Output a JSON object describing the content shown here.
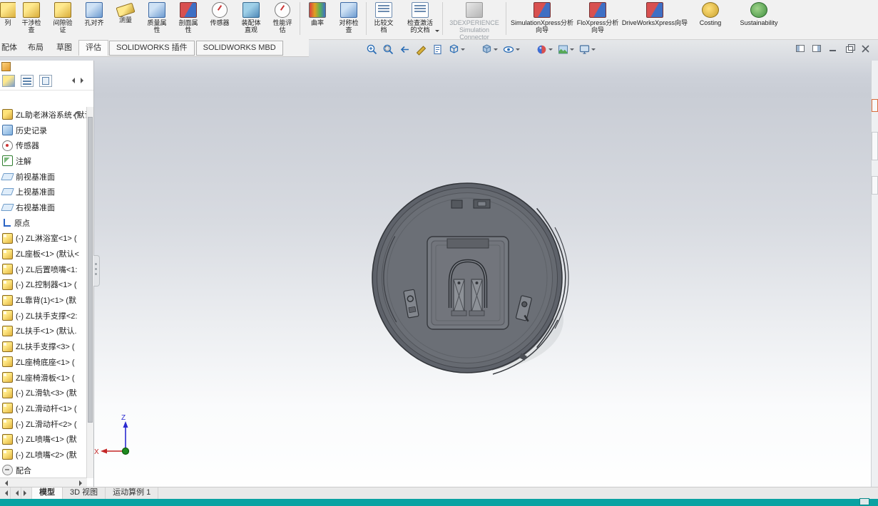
{
  "colors": {
    "status_bar": "#0aa2a2",
    "ribbon_bg": "#f1f1f1",
    "viewport_top": "#c9cdd5",
    "model_gray": "#63676d",
    "disabled_text": "#9aa0a6"
  },
  "ribbon": {
    "partial_label": "列",
    "buttons": [
      {
        "name": "interference-check",
        "label": "干涉检查"
      },
      {
        "name": "clearance-verification",
        "label": "间隙验证"
      },
      {
        "name": "hole-alignment",
        "label": "孔对齐"
      },
      {
        "name": "measure",
        "label": "测量"
      },
      {
        "name": "mass-properties",
        "label": "质量属性"
      },
      {
        "name": "section-properties",
        "label": "剖面属性"
      },
      {
        "name": "sensor",
        "label": "传感器"
      },
      {
        "name": "assembly-visualization",
        "label": "装配体直观"
      },
      {
        "name": "performance-evaluation",
        "label": "性能评估"
      },
      {
        "name": "curvature",
        "label": "曲率"
      },
      {
        "name": "symmetry-check",
        "label": "对称检查"
      },
      {
        "name": "compare-documents",
        "label": "比较文档"
      },
      {
        "name": "check-active-document",
        "label": "检查激活的文档",
        "dropdown": true
      },
      {
        "name": "3dexperience-simulation-connector",
        "label": "3DEXPERIENCE Simulation Connector",
        "disabled": true
      },
      {
        "name": "simulationxpress-wizard",
        "label": "SimulationXpress分析向导"
      },
      {
        "name": "floxpress-wizard",
        "label": "FloXpress分析向导"
      },
      {
        "name": "driveworksxpress-wizard",
        "label": "DriveWorksXpress向导"
      },
      {
        "name": "costing",
        "label": "Costing"
      },
      {
        "name": "sustainability",
        "label": "Sustainability"
      }
    ]
  },
  "command_tabs": {
    "items": [
      {
        "label": "配体",
        "clipped": true
      },
      {
        "label": "布局"
      },
      {
        "label": "草图"
      },
      {
        "label": "评估",
        "active": true
      },
      {
        "label": "SOLIDWORKS 插件",
        "boxed": true
      },
      {
        "label": "SOLIDWORKS MBD",
        "boxed": true
      }
    ]
  },
  "headsup": {
    "buttons": [
      {
        "icon": "zoom-fit"
      },
      {
        "icon": "zoom-area"
      },
      {
        "icon": "previous-view"
      },
      {
        "icon": "section-view"
      },
      {
        "icon": "dynamic-annotation-views"
      },
      {
        "icon": "view-orientation",
        "dropdown": true
      },
      {
        "icon": "display-style",
        "dropdown": true
      },
      {
        "icon": "hide-show-items",
        "dropdown": true
      },
      {
        "icon": "edit-appearance",
        "dropdown": true
      },
      {
        "icon": "apply-scene",
        "dropdown": true
      },
      {
        "icon": "view-settings",
        "dropdown": true
      }
    ]
  },
  "window_controls": [
    "collapse-pane-left",
    "collapse-pane-right",
    "minimize",
    "restore-down",
    "close"
  ],
  "panel": {
    "toolbar_icons": [
      "featuremanager-tree",
      "propertymanager",
      "configurationmanager",
      "scroll-left",
      "scroll-right"
    ]
  },
  "feature_tree": {
    "items": [
      {
        "icon": "assembly",
        "label": "ZL助老淋浴系统 (默认"
      },
      {
        "icon": "history-folder",
        "label": "历史记录"
      },
      {
        "icon": "sensors-folder",
        "label": "传感器"
      },
      {
        "icon": "annotations-folder",
        "label": "注解"
      },
      {
        "icon": "plane",
        "label": "前视基准面"
      },
      {
        "icon": "plane",
        "label": "上视基准面"
      },
      {
        "icon": "plane",
        "label": "右视基准面"
      },
      {
        "icon": "origin",
        "label": "原点"
      },
      {
        "icon": "part",
        "label": "(-) ZL淋浴室<1> ("
      },
      {
        "icon": "part",
        "label": "ZL座板<1> (默认<"
      },
      {
        "icon": "part",
        "label": "(-) ZL后置喷嘴<1:"
      },
      {
        "icon": "part",
        "label": "(-) ZL控制器<1> ("
      },
      {
        "icon": "part",
        "label": "ZL靠背(1)<1> (默"
      },
      {
        "icon": "part",
        "label": "(-) ZL扶手支撑<2:"
      },
      {
        "icon": "part",
        "label": "ZL扶手<1> (默认."
      },
      {
        "icon": "part",
        "label": "ZL扶手支撑<3> ("
      },
      {
        "icon": "part",
        "label": "ZL座椅底座<1> ("
      },
      {
        "icon": "part",
        "label": "ZL座椅滑板<1> ("
      },
      {
        "icon": "part",
        "label": "(-) ZL滑轨<3> (默"
      },
      {
        "icon": "part",
        "label": "(-) ZL滑动杆<1> ("
      },
      {
        "icon": "part",
        "label": "(-) ZL滑动杆<2> ("
      },
      {
        "icon": "part",
        "label": "(-) ZL喷嘴<1> (默"
      },
      {
        "icon": "part",
        "label": "(-) ZL喷嘴<2> (默"
      },
      {
        "icon": "mates-folder",
        "label": "配合"
      }
    ]
  },
  "triad": {
    "x_label": "X",
    "z_label": "Z"
  },
  "model_tabs": {
    "items": [
      {
        "label": "模型",
        "active": true
      },
      {
        "label": "3D 视图"
      },
      {
        "label": "运动算例 1"
      }
    ]
  }
}
